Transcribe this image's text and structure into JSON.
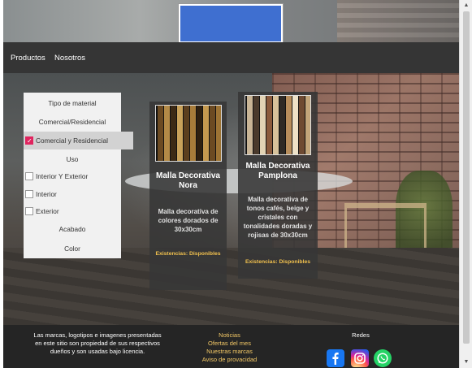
{
  "nav": {
    "items": [
      "Productos",
      "Nosotros"
    ]
  },
  "filters": {
    "material_header": "Tipo de material",
    "commercial_option": "Comercial/Residencial",
    "selected_option": "Comercial y Residencial",
    "use_header": "Uso",
    "use_options": [
      "Interior Y Exterior",
      "Interior",
      "Exterior"
    ],
    "finish_header": "Acabado",
    "color_header": "Color"
  },
  "products": [
    {
      "name": "Malla Decorativa Nora",
      "description": "Malla decorativa de colores dorados de 30x30cm",
      "stock": "Existencias: Disponibles"
    },
    {
      "name": "Malla Decorativa Pamplona",
      "description": "Malla decorativa de tonos cafés, beige y cristales con tonalidades doradas y rojisas de 30x30cm",
      "stock": "Existencias: Disponibles"
    }
  ],
  "footer": {
    "legal": "Las marcas, logotipos e imagenes presentadas en este sitio son propiedad de sus respectivos dueños y son usadas bajo licencia.",
    "links": [
      "Noticias",
      "Ofertas del mes",
      "Nuestras marcas",
      "Aviso de provacidad"
    ],
    "social_title": "Redes",
    "social_icons": [
      "facebook-icon",
      "instagram-icon",
      "whatsapp-icon"
    ]
  },
  "colors": {
    "logo_blue": "#3f6fd0",
    "stock_yellow": "#f1c14e",
    "checkbox_pink": "#e0245e"
  }
}
